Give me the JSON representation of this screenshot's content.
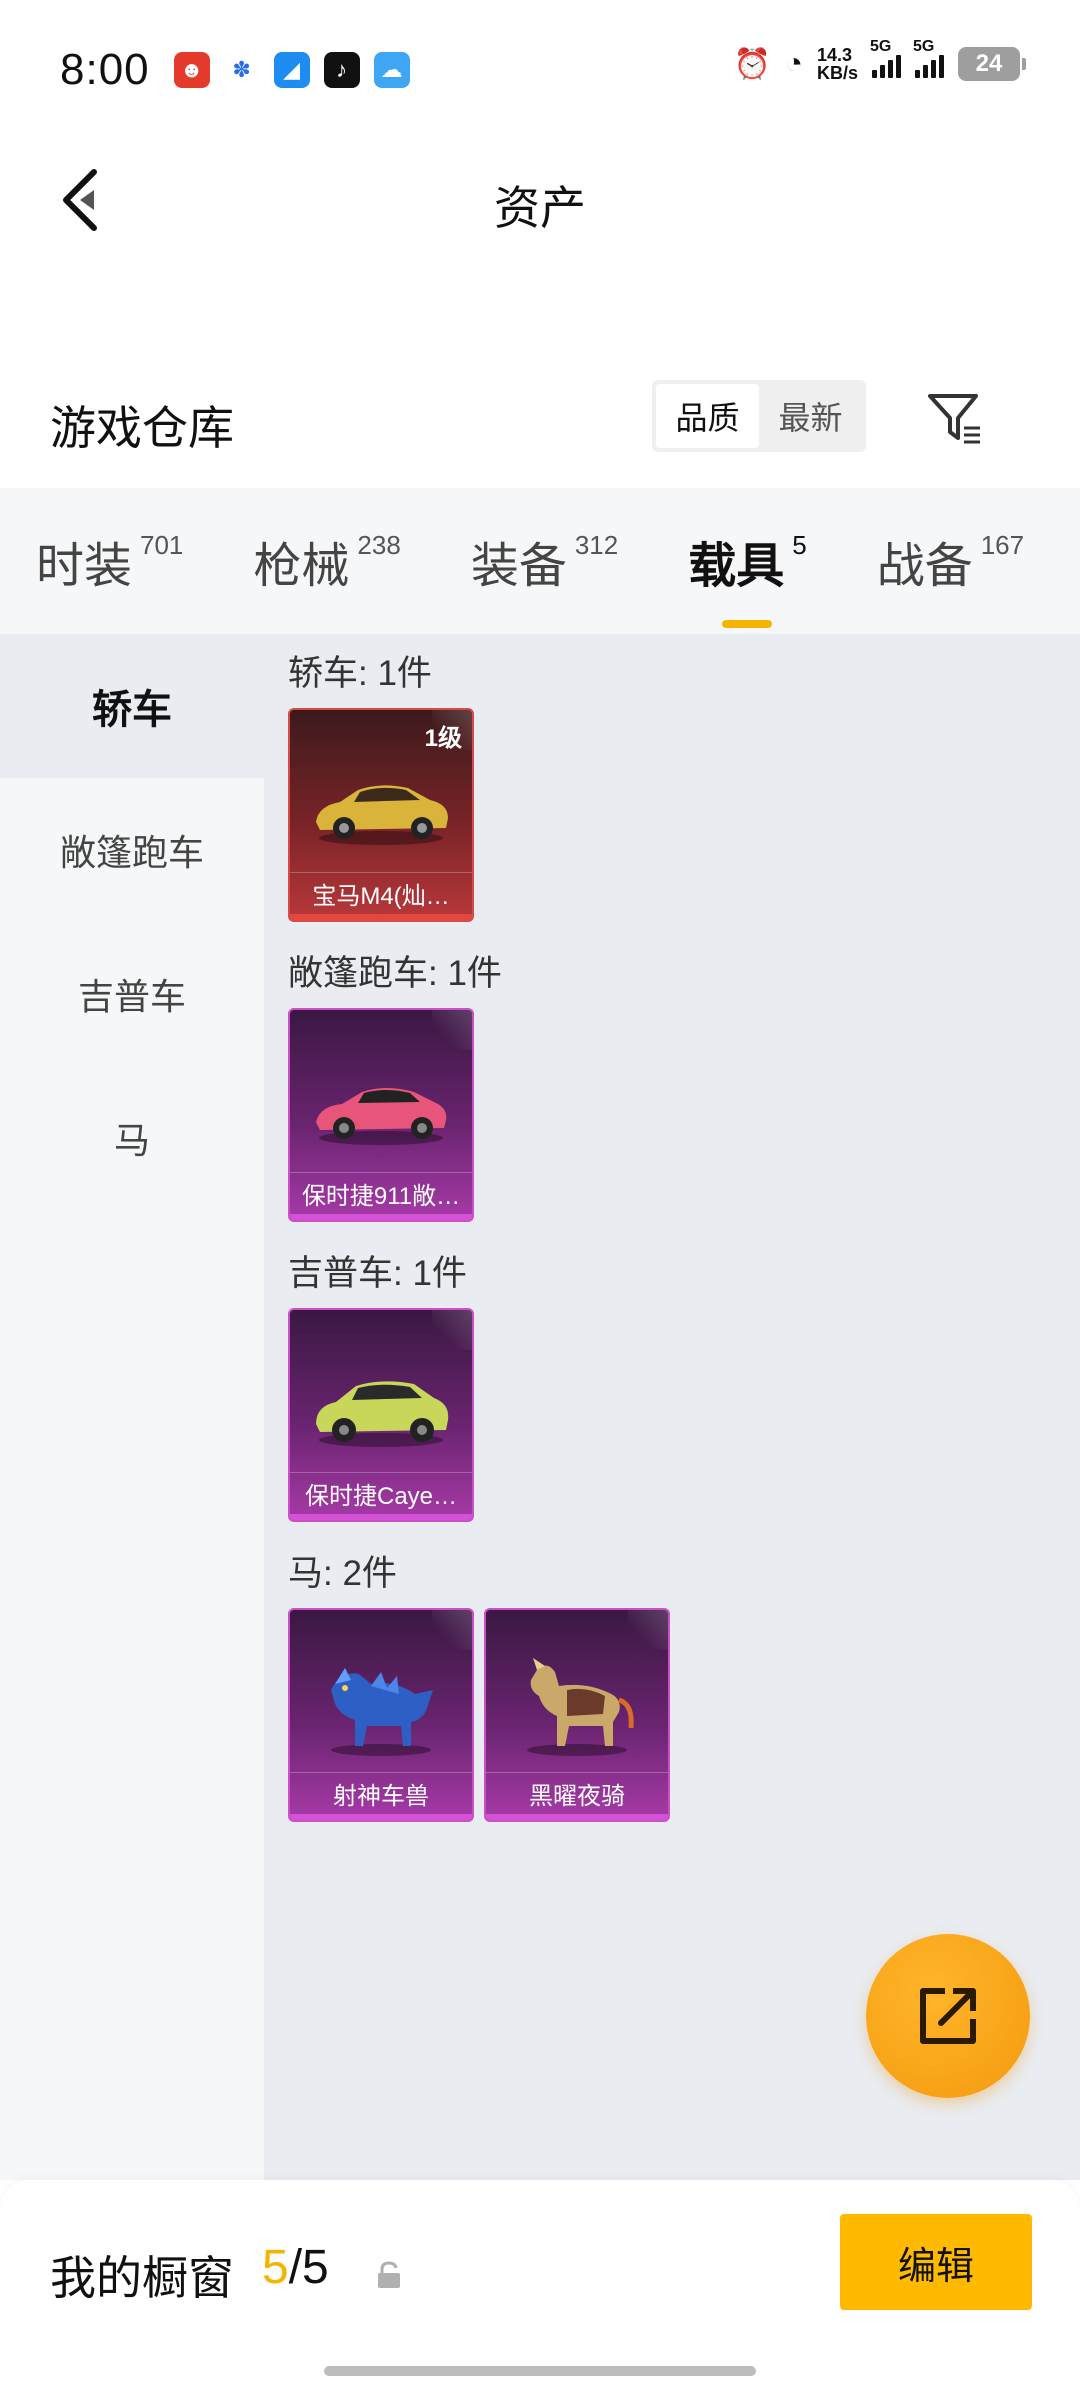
{
  "status_bar": {
    "time": "8:00",
    "speed_value": "14.3",
    "speed_unit": "KB/s",
    "network_1": "5G",
    "network_2": "5G",
    "battery": "24",
    "notification_icons": [
      "app-red-icon",
      "baidu-icon",
      "blue-app-icon",
      "tiktok-icon",
      "weather-icon"
    ]
  },
  "header": {
    "title": "资产"
  },
  "warehouse": {
    "title": "游戏仓库",
    "sort_options": [
      "品质",
      "最新"
    ],
    "sort_active": "品质"
  },
  "tabs": [
    {
      "label": "时装",
      "count": "701"
    },
    {
      "label": "枪械",
      "count": "238"
    },
    {
      "label": "装备",
      "count": "312"
    },
    {
      "label": "载具",
      "count": "5"
    },
    {
      "label": "战备",
      "count": "167"
    }
  ],
  "active_tab": "载具",
  "sidebar": {
    "items": [
      "轿车",
      "敞篷跑车",
      "吉普车",
      "马"
    ],
    "active": "轿车"
  },
  "sections": [
    {
      "title": "轿车: 1件",
      "items": [
        {
          "name": "宝马M4(灿…",
          "level": "1级",
          "rarity": "red"
        }
      ]
    },
    {
      "title": "敞篷跑车: 1件",
      "items": [
        {
          "name": "保时捷911敞…",
          "rarity": "purple"
        }
      ]
    },
    {
      "title": "吉普车: 1件",
      "items": [
        {
          "name": "保时捷Caye…",
          "rarity": "purple"
        }
      ]
    },
    {
      "title": "马: 2件",
      "items": [
        {
          "name": "射神车兽",
          "rarity": "purple"
        },
        {
          "name": "黑曜夜骑",
          "rarity": "purple"
        }
      ]
    }
  ],
  "bottom_bar": {
    "label": "我的橱窗",
    "count_current": "5",
    "count_sep": "/",
    "count_total": "5",
    "edit_label": "编辑"
  },
  "colors": {
    "accent": "#f5b400",
    "fab": "#f7a418",
    "rarity_red": "#d84a45",
    "rarity_purple": "#cc4fc8"
  }
}
